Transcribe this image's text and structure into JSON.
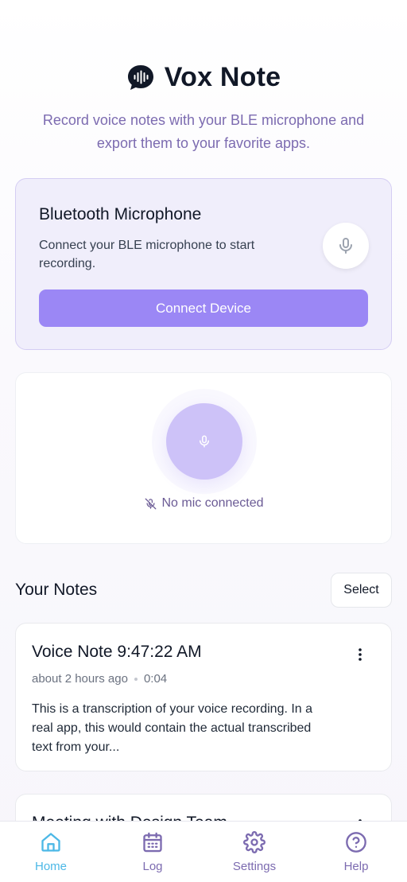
{
  "app": {
    "title": "Vox Note",
    "tagline": "Record voice notes with your BLE microphone and export them to your favorite apps."
  },
  "bluetooth": {
    "title": "Bluetooth Microphone",
    "description": "Connect your BLE microphone to start recording.",
    "connect_label": "Connect Device"
  },
  "recorder": {
    "status": "No mic connected"
  },
  "notes": {
    "title": "Your Notes",
    "select_label": "Select",
    "items": [
      {
        "title": "Voice Note 9:47:22 AM",
        "time_ago": "about 2 hours ago",
        "duration": "0:04",
        "preview": "This is a transcription of your voice recording. In a real app, this would contain the actual transcribed text from your..."
      },
      {
        "title": "Meeting with Design Team"
      }
    ]
  },
  "nav": {
    "items": [
      {
        "label": "Home",
        "icon": "home-icon"
      },
      {
        "label": "Log",
        "icon": "calendar-icon"
      },
      {
        "label": "Settings",
        "icon": "gear-icon"
      },
      {
        "label": "Help",
        "icon": "help-icon"
      }
    ],
    "active": "Home"
  },
  "colors": {
    "accent": "#9b87f5",
    "accent_light": "#cdc2f8",
    "nav_active": "#4cb8e6",
    "nav_inactive": "#7c6bb0"
  }
}
